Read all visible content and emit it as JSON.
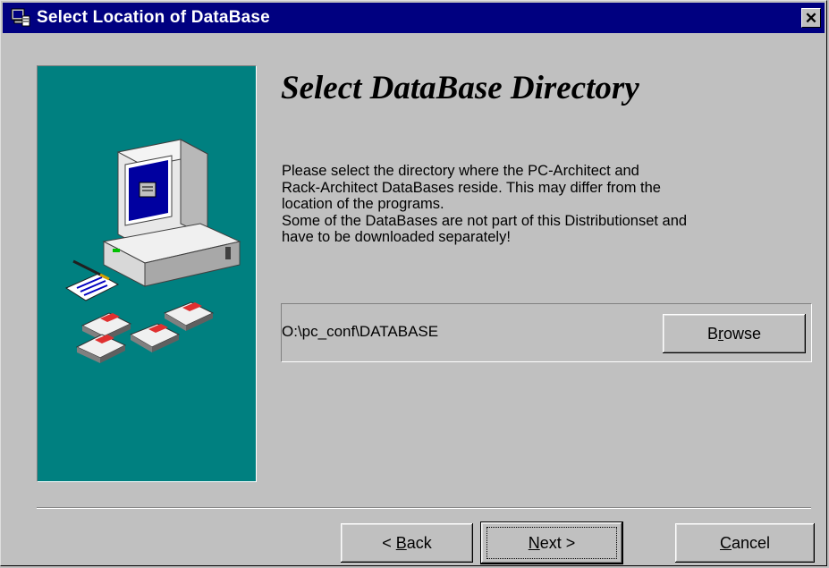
{
  "window": {
    "title": "Select Location of DataBase",
    "close_symbol": "✕",
    "icon": "setup-computer-icon"
  },
  "page": {
    "heading": "Select DataBase Directory",
    "description_lines": [
      "Please select the directory where the PC-Architect and",
      "Rack-Architect DataBases reside. This may differ from the",
      "location of the programs.",
      "Some of the DataBases are not part of this Distributionset and",
      "have to be downloaded separately!"
    ],
    "path_value": "O:\\pc_conf\\DATABASE",
    "illustration": "computer-with-disks-icon"
  },
  "buttons": {
    "browse": {
      "label": "Browse",
      "mnemonic_index": 1
    },
    "back": {
      "label": "< Back",
      "mnemonic_index": 2
    },
    "next": {
      "label": "Next >",
      "mnemonic_index": 0
    },
    "cancel": {
      "label": "Cancel",
      "mnemonic_index": 0
    }
  },
  "colors": {
    "titlebar": "#000080",
    "panel": "#008080",
    "face": "#c0c0c0"
  }
}
